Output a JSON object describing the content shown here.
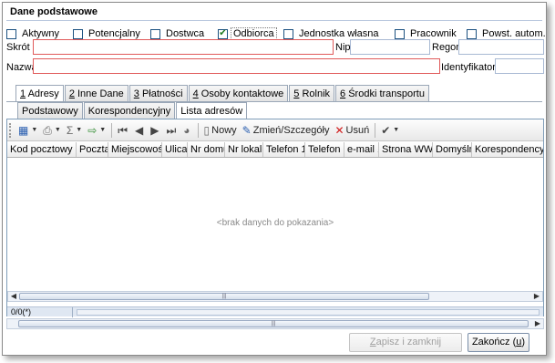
{
  "title": "Dane podstawowe",
  "checkboxes": [
    {
      "label": "Aktywny",
      "checked": false
    },
    {
      "label": "Potencjalny",
      "checked": false
    },
    {
      "label": "Dostwca",
      "checked": false
    },
    {
      "label": "Odbiorca",
      "checked": true
    },
    {
      "label": "Jednostka własna",
      "checked": false
    },
    {
      "label": "Pracownik",
      "checked": false
    },
    {
      "label": "Powst. autom.",
      "checked": false
    }
  ],
  "fields": {
    "skrot_label": "Skrót",
    "nip_label": "Nip",
    "regon_label": "Regon",
    "nazwa_label": "Nazwa",
    "identyfikator_label": "Identyfikator",
    "skrot_value": "",
    "nip_value": "",
    "regon_value": "",
    "nazwa_value": "",
    "identyfikator_value": ""
  },
  "main_tabs": [
    {
      "key": "1",
      "label": " Adresy",
      "active": true
    },
    {
      "key": "2",
      "label": " Inne Dane",
      "active": false
    },
    {
      "key": "3",
      "label": " Płatności",
      "active": false
    },
    {
      "key": "4",
      "label": " Osoby kontaktowe",
      "active": false
    },
    {
      "key": "5",
      "label": " Rolnik",
      "active": false
    },
    {
      "key": "6",
      "label": " Środki transportu",
      "active": false
    }
  ],
  "sub_tabs": [
    {
      "label": "Podstawowy",
      "active": false
    },
    {
      "label": "Korespondencyjny",
      "active": false
    },
    {
      "label": "Lista adresów",
      "active": true
    }
  ],
  "toolbar": {
    "new_label": "Nowy",
    "edit_label": "Zmień/Szczegóły",
    "delete_label": "Usuń"
  },
  "columns": [
    "Kod pocztowy",
    "Poczta",
    "Miejscowość",
    "Ulica",
    "Nr domu",
    "Nr lokalu",
    "Telefon 1",
    "Telefon 2",
    "e-mail 1",
    "Strona WWW",
    "Domyślny",
    "Korespondency"
  ],
  "empty_text": "<brak danych do pokazania>",
  "status_text": "0/0(*)",
  "buttons": {
    "save_close": "apisz i zamknij",
    "save_close_key": "Z",
    "finish": "Zakończ (",
    "finish_key": "u",
    "finish_end": ")"
  },
  "colors": {
    "required_border": "#e05a5a",
    "check_green": "#1d7a1d"
  }
}
